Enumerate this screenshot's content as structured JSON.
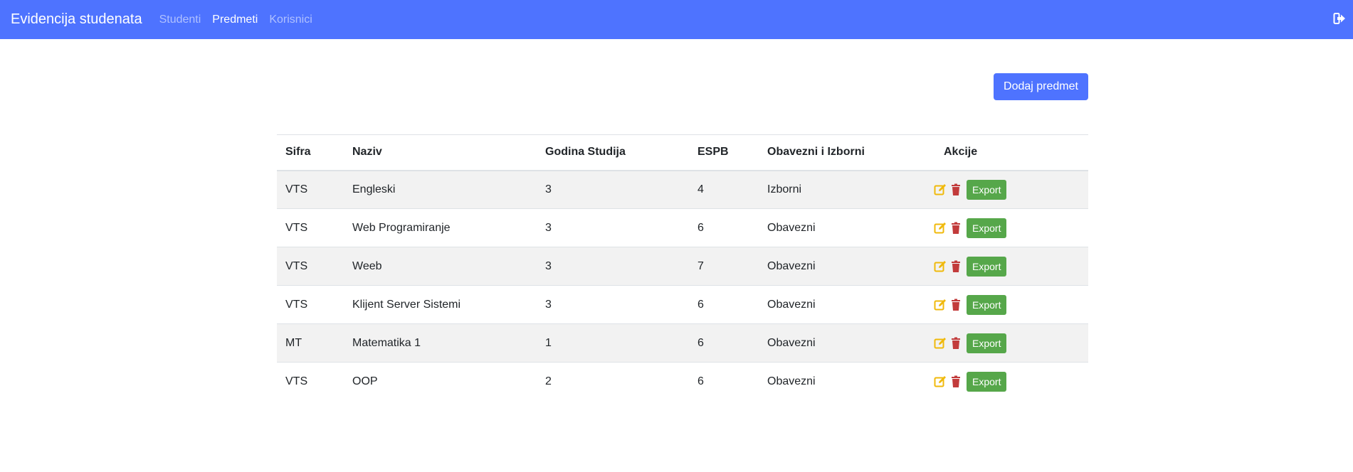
{
  "navbar": {
    "brand": "Evidencija studenata",
    "links": [
      {
        "label": "Studenti",
        "active": false
      },
      {
        "label": "Predmeti",
        "active": true
      },
      {
        "label": "Korisnici",
        "active": false
      }
    ],
    "logout_icon": "sign-out-icon"
  },
  "toolbar": {
    "add_label": "Dodaj predmet"
  },
  "table": {
    "headers": [
      "Sifra",
      "Naziv",
      "Godina Studija",
      "ESPB",
      "Obavezni i Izborni",
      "Akcije"
    ],
    "rows": [
      {
        "sifra": "VTS",
        "naziv": "Engleski",
        "godina": "3",
        "espb": "4",
        "tip": "Izborni"
      },
      {
        "sifra": "VTS",
        "naziv": "Web Programiranje",
        "godina": "3",
        "espb": "6",
        "tip": "Obavezni"
      },
      {
        "sifra": "VTS",
        "naziv": "Weeb",
        "godina": "3",
        "espb": "7",
        "tip": "Obavezni"
      },
      {
        "sifra": "VTS",
        "naziv": "Klijent Server Sistemi",
        "godina": "3",
        "espb": "6",
        "tip": "Obavezni"
      },
      {
        "sifra": "MT",
        "naziv": "Matematika 1",
        "godina": "1",
        "espb": "6",
        "tip": "Obavezni"
      },
      {
        "sifra": "VTS",
        "naziv": "OOP",
        "godina": "2",
        "espb": "6",
        "tip": "Obavezni"
      }
    ],
    "export_label": "Export",
    "edit_icon": "edit-icon",
    "delete_icon": "trash-icon"
  },
  "colors": {
    "primary": "#4e73ff",
    "edit": "#f0b90b",
    "delete": "#c23b3b",
    "export": "#56a74a"
  }
}
